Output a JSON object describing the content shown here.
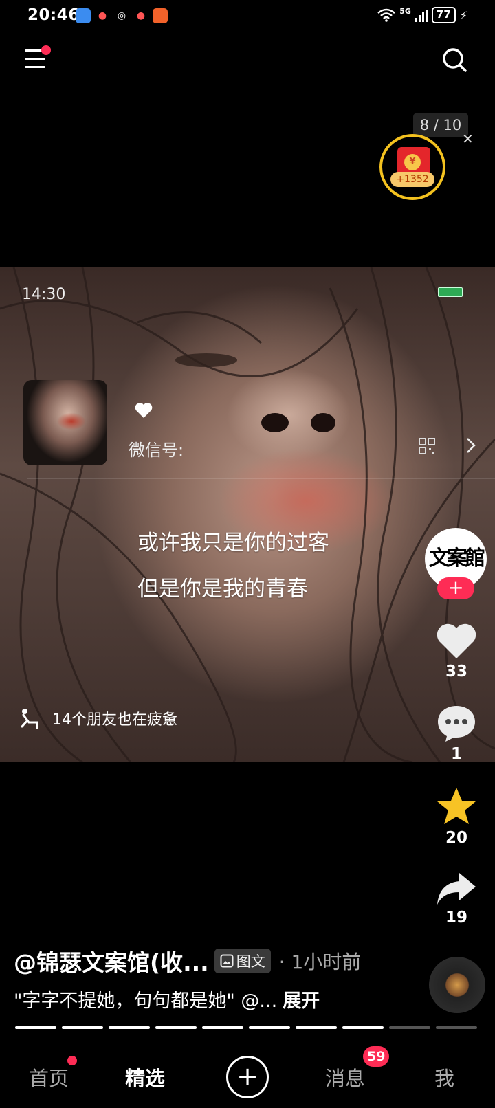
{
  "status_bar": {
    "time": "20:46",
    "network": "5G",
    "battery": "77"
  },
  "reward": {
    "progress_text": "8 / 10",
    "amount": "+1352"
  },
  "post": {
    "photo_time": "14:30",
    "wechat_label": "微信号:",
    "caption_lines": [
      "或许我只是你的过客",
      "但是你是我的青春"
    ],
    "friends_text": "14个朋友也在疲惫",
    "author": "@锦瑟文案馆(收...",
    "type_badge": "图文",
    "time_ago": "· 1小时前",
    "description": "\"字字不提她，句句都是她\" @...",
    "expand_label": "展开",
    "image_count": 10,
    "current_image": 8
  },
  "actions": {
    "author_avatar_text": "文案館",
    "likes": "33",
    "comments": "1",
    "favorites": "20",
    "shares": "19"
  },
  "tabs": {
    "home": "首页",
    "featured": "精选",
    "add": "+",
    "messages": "消息",
    "messages_badge": "59",
    "me": "我"
  },
  "colors": {
    "accent": "#fe2c55",
    "favorite": "#f7c325",
    "reward_ring": "#f4c21f"
  }
}
